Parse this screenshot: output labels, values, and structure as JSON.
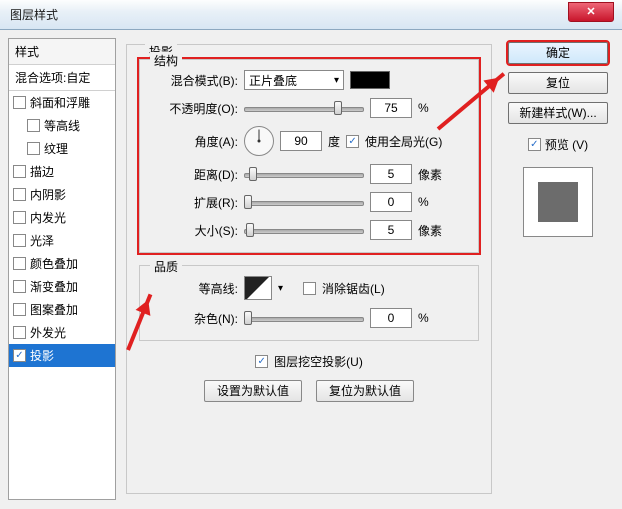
{
  "title": "图层样式",
  "left": {
    "header": "样式",
    "sub": "混合选项:自定",
    "items": [
      {
        "label": "斜面和浮雕",
        "checked": false,
        "indent": false
      },
      {
        "label": "等高线",
        "checked": false,
        "indent": true
      },
      {
        "label": "纹理",
        "checked": false,
        "indent": true
      },
      {
        "label": "描边",
        "checked": false,
        "indent": false
      },
      {
        "label": "内阴影",
        "checked": false,
        "indent": false
      },
      {
        "label": "内发光",
        "checked": false,
        "indent": false
      },
      {
        "label": "光泽",
        "checked": false,
        "indent": false
      },
      {
        "label": "颜色叠加",
        "checked": false,
        "indent": false
      },
      {
        "label": "渐变叠加",
        "checked": false,
        "indent": false
      },
      {
        "label": "图案叠加",
        "checked": false,
        "indent": false
      },
      {
        "label": "外发光",
        "checked": false,
        "indent": false
      },
      {
        "label": "投影",
        "checked": true,
        "indent": false,
        "selected": true
      }
    ]
  },
  "mid_title": "投影",
  "structure": {
    "legend": "结构",
    "blend_label": "混合模式(B):",
    "blend_value": "正片叠底",
    "swatch_color": "#000000",
    "opacity_label": "不透明度(O):",
    "opacity_value": "75",
    "opacity_unit": "%",
    "angle_label": "角度(A):",
    "angle_value": "90",
    "angle_unit": "度",
    "global_light_label": "使用全局光(G)",
    "global_light_checked": true,
    "distance_label": "距离(D):",
    "distance_value": "5",
    "distance_unit": "像素",
    "spread_label": "扩展(R):",
    "spread_value": "0",
    "spread_unit": "%",
    "size_label": "大小(S):",
    "size_value": "5",
    "size_unit": "像素"
  },
  "quality": {
    "legend": "品质",
    "contour_label": "等高线:",
    "antialias_label": "消除锯齿(L)",
    "antialias_checked": false,
    "noise_label": "杂色(N):",
    "noise_value": "0",
    "noise_unit": "%"
  },
  "knockout_label": "图层挖空投影(U)",
  "knockout_checked": true,
  "default_set": "设置为默认值",
  "default_reset": "复位为默认值",
  "right": {
    "ok": "确定",
    "cancel": "复位",
    "new_style": "新建样式(W)...",
    "preview_label": "预览 (V)",
    "preview_checked": true
  }
}
